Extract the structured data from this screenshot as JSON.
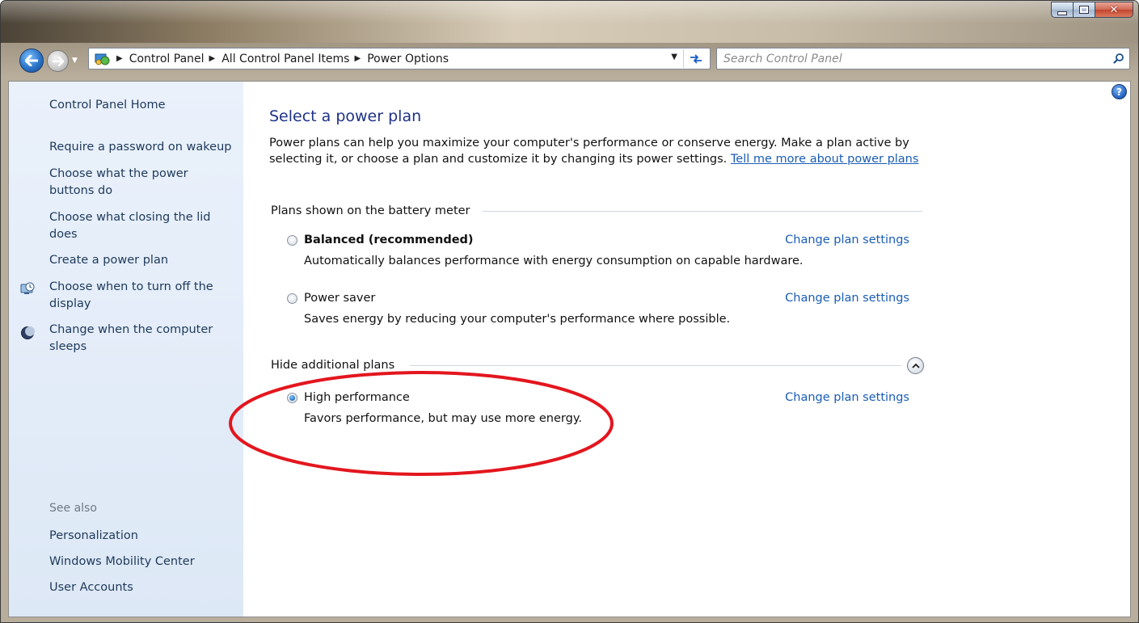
{
  "navigation": {
    "breadcrumbs": [
      "Control Panel",
      "All Control Panel Items",
      "Power Options"
    ]
  },
  "search": {
    "placeholder": "Search Control Panel"
  },
  "sidebar": {
    "home": "Control Panel Home",
    "links": [
      "Require a password on wakeup",
      "Choose what the power buttons do",
      "Choose what closing the lid does",
      "Create a power plan",
      "Choose when to turn off the display",
      "Change when the computer sleeps"
    ],
    "see_also_label": "See also",
    "see_also": [
      "Personalization",
      "Windows Mobility Center",
      "User Accounts"
    ]
  },
  "main": {
    "title": "Select a power plan",
    "intro": "Power plans can help you maximize your computer's performance or conserve energy. Make a plan active by selecting it, or choose a plan and customize it by changing its power settings.",
    "intro_link": "Tell me more about power plans",
    "battery_group_label": "Plans shown on the battery meter",
    "additional_group_label": "Hide additional plans",
    "change_settings_label": "Change plan settings",
    "plans": [
      {
        "name": "Balanced (recommended)",
        "description": "Automatically balances performance with energy consumption on capable hardware.",
        "selected": false
      },
      {
        "name": "Power saver",
        "description": "Saves energy by reducing your computer's performance where possible.",
        "selected": false
      },
      {
        "name": "High performance",
        "description": "Favors performance, but may use more energy.",
        "selected": true
      }
    ]
  },
  "colors": {
    "link": "#1a5db5",
    "title": "#1e3287",
    "sidebar_bg": "#dde8f6",
    "annotation": "#e3161e"
  },
  "icons": {
    "display": "monitor-clock-icon",
    "sleep": "moon-icon",
    "help": "help-icon",
    "search": "search-icon",
    "collapse": "chevron-up-icon"
  }
}
